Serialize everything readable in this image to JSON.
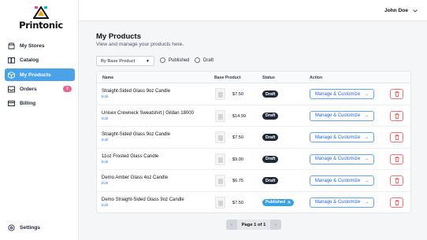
{
  "brand": {
    "name": "Printonic"
  },
  "sidebar": {
    "items": [
      {
        "label": "My Stores",
        "icon": "store-icon"
      },
      {
        "label": "Catalog",
        "icon": "book-icon"
      },
      {
        "label": "My Products",
        "icon": "box-icon",
        "active": true
      },
      {
        "label": "Orders",
        "icon": "inbox-icon",
        "badge": "2"
      },
      {
        "label": "Billing",
        "icon": "card-icon"
      }
    ],
    "settings_label": "Settings"
  },
  "header": {
    "user_name": "John Doe"
  },
  "main": {
    "title": "My Products",
    "subtitle": "View and manage your products here.",
    "filter": {
      "select_value": "By Base Product",
      "radio_published": "Published",
      "radio_draft": "Draft"
    }
  },
  "table": {
    "headers": {
      "name": "Name",
      "base_product": "Base Product",
      "status": "Status",
      "action": "Action"
    },
    "edit_label": "Edit",
    "manage_label": "Manage & Customize",
    "rows": [
      {
        "name": "Straight-Sided Glass 9oz Candle",
        "price": "$7.50",
        "status": "Draft"
      },
      {
        "name": "Unisex Crewneck Sweatshirt | Gildan 18000",
        "price": "$14.99",
        "status": "Draft"
      },
      {
        "name": "Straight-Sided Glass 9oz Candle",
        "price": "$7.50",
        "status": "Draft"
      },
      {
        "name": "11oz Frosted Glass Candle",
        "price": "$9.00",
        "status": "Draft"
      },
      {
        "name": "Demo Amber Glass 4oz Candle",
        "price": "$6.75",
        "status": "Draft"
      },
      {
        "name": "Demo Straight-Sided Glass 9oz Candle",
        "price": "$7.50",
        "status": "Published"
      }
    ]
  },
  "pagination": {
    "label": "Page 1 of 1"
  },
  "colors": {
    "accent": "#4aa3e8",
    "badge": "#f0608f",
    "draft": "#1f2937",
    "published": "#3b9fe3",
    "danger": "#f87171"
  }
}
